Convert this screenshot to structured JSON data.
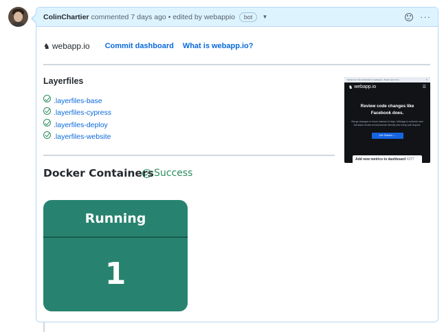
{
  "comment": {
    "author": "ColinChartier",
    "action": "commented",
    "time": "7 days ago",
    "edited_prefix": "• edited by",
    "editor": "webappio",
    "badge": "bot"
  },
  "links_row": {
    "logo_text": "webapp.io",
    "commit_dashboard": "Commit dashboard",
    "what_is": "What is webapp.io?"
  },
  "layerfiles": {
    "heading": "Layerfiles",
    "items": [
      {
        "label": ".layerfiles-base"
      },
      {
        "label": ".layerfiles-cypress"
      },
      {
        "label": ".layerfiles-deploy"
      },
      {
        "label": ".layerfiles-website"
      }
    ]
  },
  "preview": {
    "banner_text": "Spiral.com has rebranded to webapp.io. Read more here",
    "logo_text": "webapp.io",
    "title": "Review code changes like Facebook does.",
    "description": "Merge changes in hours instead of days. Webapp.io embeds new full-stack review environments directly into every pull request.",
    "button": "Get Started →",
    "card_title": "Add new metrics to dashboard",
    "card_number": "#377"
  },
  "docker": {
    "heading": "Docker Containers",
    "status": "Success",
    "status_color": "#2a8c5c",
    "card_color": "#27836f",
    "card_label": "Running",
    "card_count": "1"
  }
}
